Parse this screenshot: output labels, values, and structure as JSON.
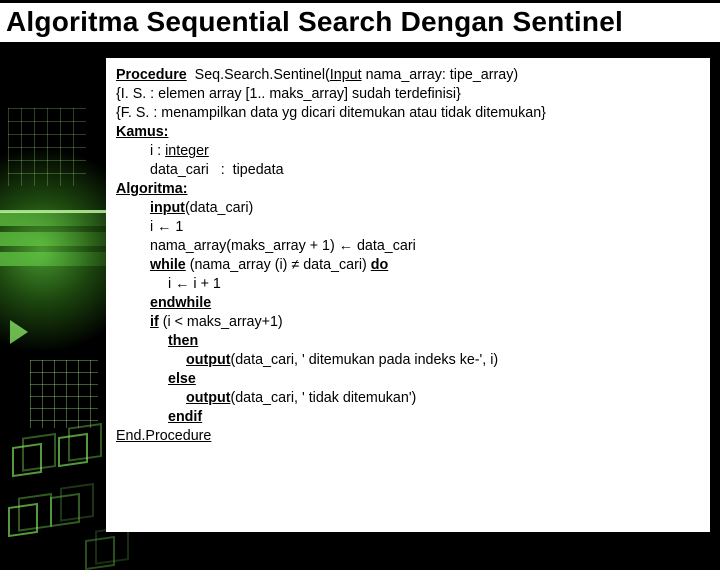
{
  "header": {
    "title": "Algoritma Sequential Search Dengan Sentinel"
  },
  "code": {
    "l1a": "Procedure",
    "l1b": "  Seq.Search.Sentinel(",
    "l1c": "Input",
    "l1d": " nama_array: tipe_array)",
    "l2": "{I. S. : elemen array [1.. maks_array] sudah terdefinisi}",
    "l3": "{F. S. : menampilkan data yg dicari ditemukan atau tidak ditemukan}",
    "l4": "Kamus:",
    "l5a": "i : ",
    "l5b": "integer",
    "l6": "data_cari   :  tipedata",
    "l7": "Algoritma:",
    "l8a": "input",
    "l8b": "(data_cari)",
    "l9": "i ← 1",
    "l10": "nama_array(maks_array + 1) ← data_cari",
    "l11a": "while",
    "l11b": " (nama_array (i) ≠ data_cari) ",
    "l11c": "do",
    "l12": "i ← i + 1",
    "l13": "endwhile",
    "l14a": "if",
    "l14b": " (i < maks_array+1)",
    "l15": "then",
    "l16a": "output",
    "l16b": "(data_cari, ' ditemukan pada indeks ke-', i)",
    "l17": "else",
    "l18a": "output",
    "l18b": "(data_cari, ' tidak ditemukan')",
    "l19": "endif",
    "l20": "End.Procedure"
  }
}
